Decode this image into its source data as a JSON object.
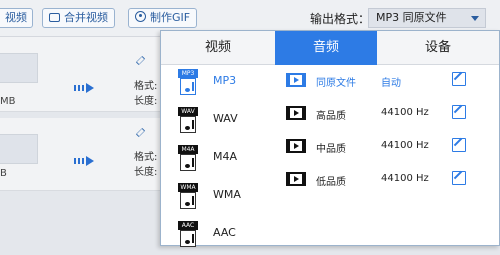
{
  "toolbar": {
    "btn1_label": "视频",
    "merge_label": "合并视频",
    "gif_label": "制作GIF",
    "format_label": "输出格式：",
    "format_value": "MP3  同原文件"
  },
  "files": [
    {
      "size": "MB",
      "meta1": "格式:",
      "meta2": "长度:"
    },
    {
      "size": "B",
      "meta1": "格式:",
      "meta2": "长度:"
    }
  ],
  "panel": {
    "tabs": [
      "视频",
      "音频",
      "设备"
    ],
    "active_tab": "音频",
    "formats": [
      {
        "tag": "MP3",
        "label": "MP3",
        "selected": true
      },
      {
        "tag": "WAV",
        "label": "WAV",
        "selected": false
      },
      {
        "tag": "M4A",
        "label": "M4A",
        "selected": false
      },
      {
        "tag": "WMA",
        "label": "WMA",
        "selected": false
      },
      {
        "tag": "AAC",
        "label": "AAC",
        "selected": false
      }
    ],
    "qualities": [
      {
        "name": "同原文件",
        "rate": "自动",
        "selected": true
      },
      {
        "name": "高品质",
        "rate": "44100 Hz",
        "selected": false
      },
      {
        "name": "中品质",
        "rate": "44100 Hz",
        "selected": false
      },
      {
        "name": "低品质",
        "rate": "44100 Hz",
        "selected": false
      }
    ]
  },
  "colors": {
    "accent": "#2d7be5",
    "link": "#2a5d9f"
  },
  "icons": [
    "video-icon",
    "merge-icon",
    "gif-icon",
    "convert-arrow-icon",
    "edit-pencil-icon",
    "audio-file-icon",
    "film-icon",
    "edit-icon",
    "dropdown-caret-icon"
  ]
}
